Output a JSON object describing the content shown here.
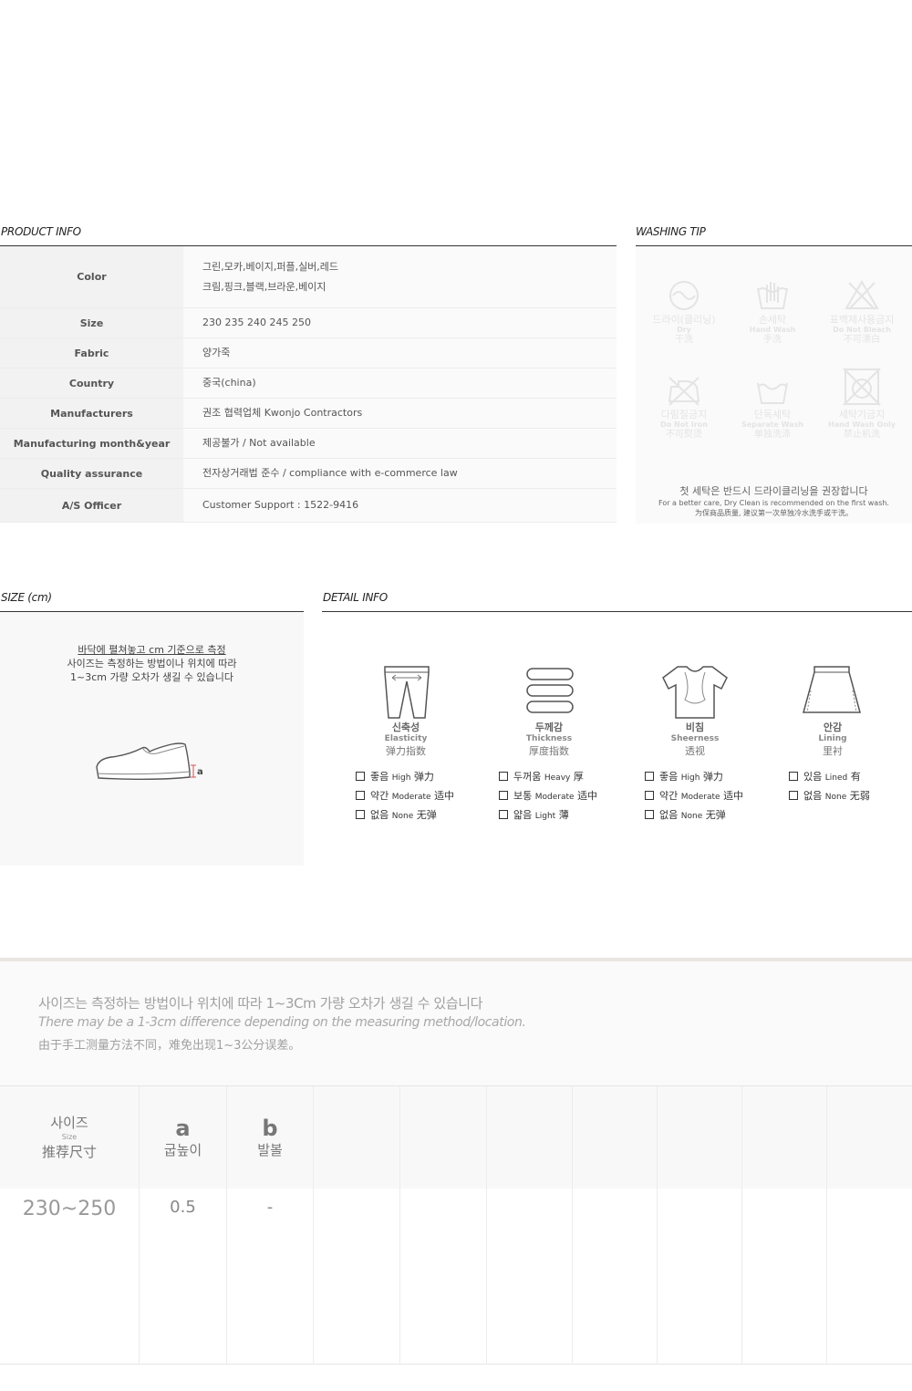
{
  "product_info": {
    "title": "PRODUCT INFO",
    "rows": [
      {
        "label": "Color",
        "lines": [
          "그린,모카,베이지,퍼플,실버,레드",
          "크림,핑크,블랙,브라운,베이지"
        ]
      },
      {
        "label": "Size",
        "lines": [
          "230 235 240 245 250"
        ]
      },
      {
        "label": "Fabric",
        "lines": [
          "양가죽"
        ]
      },
      {
        "label": "Country",
        "lines": [
          "중국(china)"
        ]
      },
      {
        "label": "Manufacturers",
        "lines": [
          "권조 협력업체 Kwonjo Contractors"
        ]
      },
      {
        "label": "Manufacturing month&year",
        "lines": [
          "제공불가 / Not available"
        ]
      },
      {
        "label": "Quality assurance",
        "lines": [
          "전자상거래법 준수 / compliance with e-commerce law"
        ]
      },
      {
        "label": "A/S Officer",
        "lines": [
          "Customer Support : 1522-9416"
        ]
      }
    ]
  },
  "washing": {
    "title": "WASHING TIP",
    "icons": [
      {
        "icon": "dry-clean-icon",
        "ko": "드라이(클리닝)",
        "en": "Dry",
        "zh": "干洗"
      },
      {
        "icon": "hand-wash-icon",
        "ko": "손세탁",
        "en": "Hand Wash",
        "zh": "手洗"
      },
      {
        "icon": "no-bleach-icon",
        "ko": "표백제사용금지",
        "en": "Do Not Bleach",
        "zh": "不可漂白"
      },
      {
        "icon": "no-iron-icon",
        "ko": "다림질금지",
        "en": "Do Not Iron",
        "zh": "不可熨烫"
      },
      {
        "icon": "separate-wash-icon",
        "ko": "단독세탁",
        "en": "Separate Wash",
        "zh": "单独洗涤"
      },
      {
        "icon": "no-machine-wash-icon",
        "ko": "세탁기금지",
        "en": "Hand Wash Only",
        "zh": "禁止机洗"
      }
    ],
    "note_ko": "첫 세탁은 반드시 드라이클리닝을 권장합니다",
    "note_en": "For a better care, Dry Clean is recommended on the first wash.",
    "note_zh": "为保商品质量, 建议第一次单独冷水洗手或干洗。"
  },
  "size_panel": {
    "title": "SIZE (cm)",
    "note1": "바닥에 펼쳐놓고 cm 기준으로 측정",
    "note2": "사이즈는 측정하는 방법이나 위치에 따라",
    "note3": "1~3cm 가량 오차가 생길 수 있습니다",
    "marker": "a"
  },
  "detail": {
    "title": "DETAIL INFO",
    "columns": [
      {
        "icon": "pants-icon",
        "ko": "신축성",
        "en": "Elasticity",
        "zh": "弹力指数",
        "options": [
          {
            "ko": "좋음",
            "en": "High",
            "zh": "弹力"
          },
          {
            "ko": "약간",
            "en": "Moderate",
            "zh": "适中"
          },
          {
            "ko": "없음",
            "en": "None",
            "zh": "无弹"
          }
        ]
      },
      {
        "icon": "layers-icon",
        "ko": "두께감",
        "en": "Thickness",
        "zh": "厚度指数",
        "options": [
          {
            "ko": "두꺼움",
            "en": "Heavy",
            "zh": "厚"
          },
          {
            "ko": "보통",
            "en": "Moderate",
            "zh": "适中"
          },
          {
            "ko": "얇음",
            "en": "Light",
            "zh": "薄"
          }
        ]
      },
      {
        "icon": "shirt-icon",
        "ko": "비침",
        "en": "Sheerness",
        "zh": "透视",
        "options": [
          {
            "ko": "좋음",
            "en": "High",
            "zh": "弹力"
          },
          {
            "ko": "약간",
            "en": "Moderate",
            "zh": "适中"
          },
          {
            "ko": "없음",
            "en": "None",
            "zh": "无弹"
          }
        ]
      },
      {
        "icon": "skirt-icon",
        "ko": "안감",
        "en": "Lining",
        "zh": "里衬",
        "options": [
          {
            "ko": "있음",
            "en": "Lined",
            "zh": "有"
          },
          {
            "ko": "없음",
            "en": "None",
            "zh": "无弱"
          }
        ]
      }
    ]
  },
  "size_notice": {
    "ko": "사이즈는 측정하는 방법이나 위치에 따라 1~3Cm 가량 오차가 생길 수 있습니다",
    "en": "There may be a 1-3cm difference depending on the measuring method/location.",
    "zh": "由于手工测量方法不同，难免出现1~3公分误差。"
  },
  "size_table": {
    "header": {
      "size_ko": "사이즈",
      "size_en": "Size",
      "size_zh": "推荐尺寸"
    },
    "columns": [
      {
        "letter": "a",
        "label": "굽높이"
      },
      {
        "letter": "b",
        "label": "발볼"
      }
    ],
    "row": {
      "size": "230~250",
      "values": [
        "0.5",
        "-"
      ]
    }
  }
}
